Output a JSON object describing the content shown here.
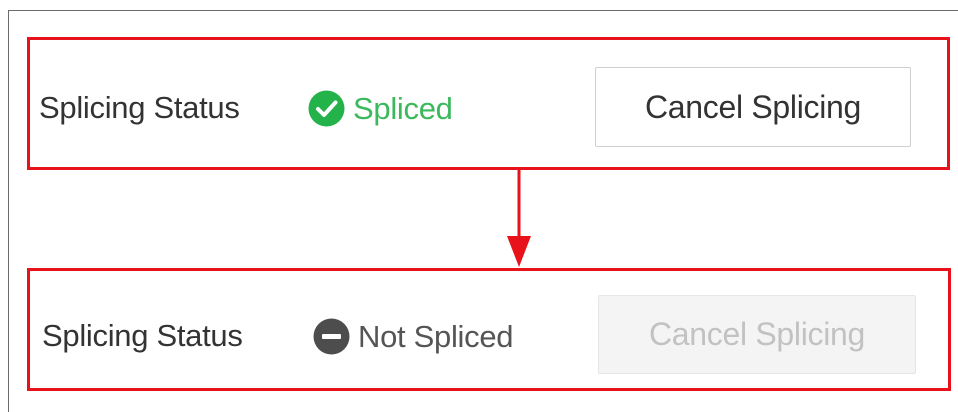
{
  "colors": {
    "highlight_border": "#e8121a",
    "spliced_green": "#3cb95c",
    "not_spliced_gray": "#4d4d4d",
    "disabled_text": "#c2c2c2"
  },
  "before": {
    "label": "Splicing Status",
    "status_icon": "check-circle-icon",
    "status_text": "Spliced",
    "button_label": "Cancel Splicing",
    "button_enabled": true
  },
  "after": {
    "label": "Splicing Status",
    "status_icon": "minus-circle-icon",
    "status_text": "Not Spliced",
    "button_label": "Cancel Splicing",
    "button_enabled": false
  },
  "transition_icon": "arrow-down-icon"
}
